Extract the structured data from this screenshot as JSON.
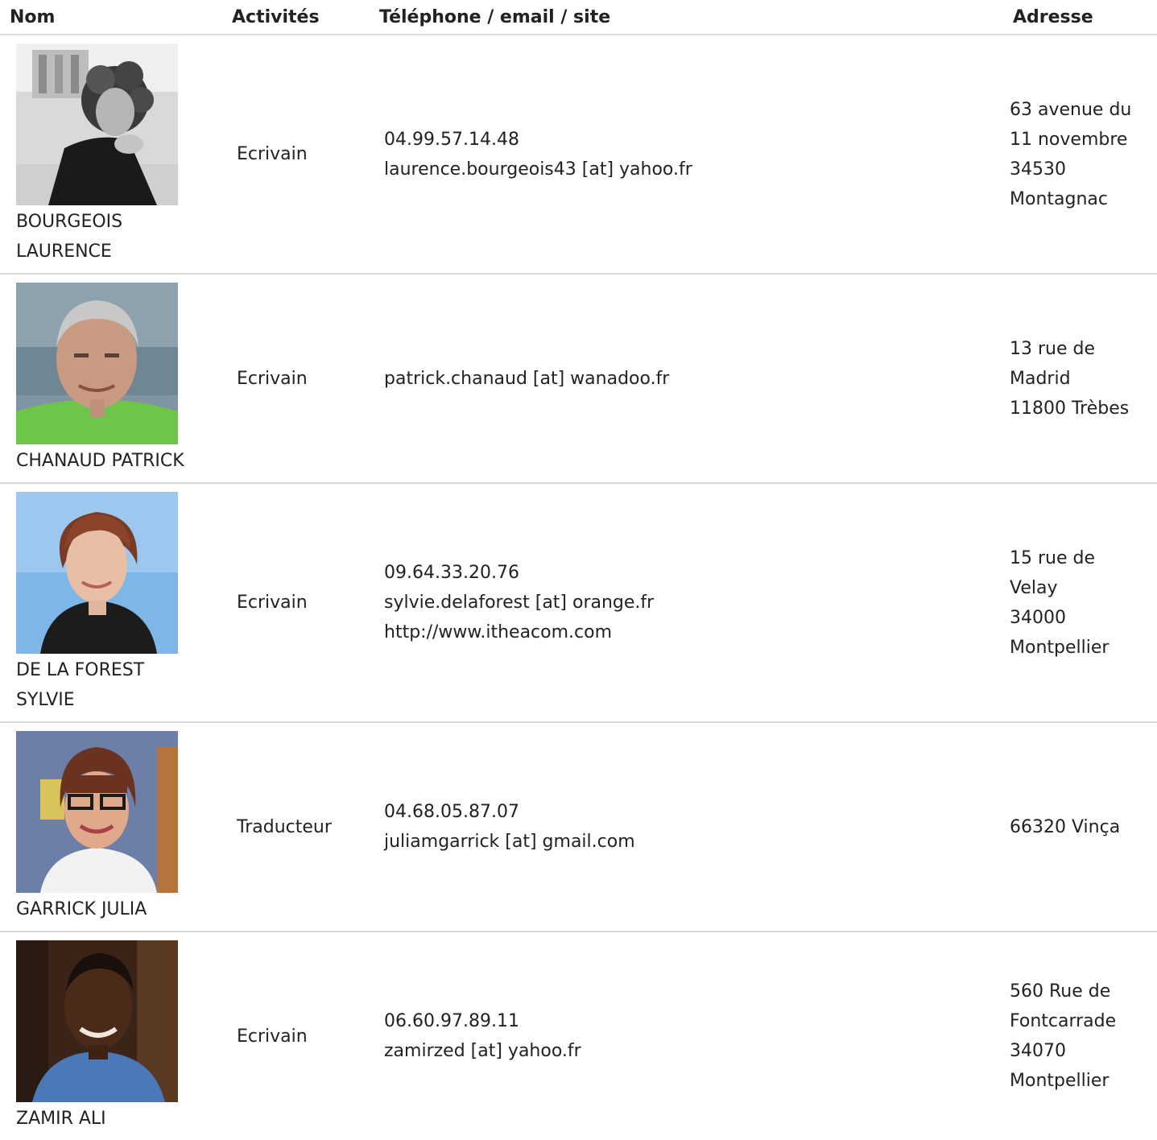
{
  "headers": {
    "nom": "Nom",
    "activites": "Activités",
    "contact": "Téléphone / email / site",
    "adresse": "Adresse"
  },
  "rows": [
    {
      "photo_icon": "portrait-photo-bw-woman-curly-hair",
      "name_lines": [
        "BOURGEOIS",
        "LAURENCE"
      ],
      "activity": "Ecrivain",
      "contact_lines": [
        "04.99.57.14.48",
        "laurence.bourgeois43 [at] yahoo.fr"
      ],
      "address_lines": [
        "63 avenue du",
        "11 novembre",
        "34530",
        "Montagnac"
      ]
    },
    {
      "photo_icon": "portrait-photo-man-green-shirt",
      "name_lines": [
        "CHANAUD PATRICK"
      ],
      "activity": "Ecrivain",
      "contact_lines": [
        "patrick.chanaud [at] wanadoo.fr"
      ],
      "address_lines": [
        "13 rue de",
        "Madrid",
        "11800 Trèbes"
      ]
    },
    {
      "photo_icon": "portrait-photo-woman-blue-background",
      "name_lines": [
        "DE LA FOREST",
        "SYLVIE"
      ],
      "activity": "Ecrivain",
      "contact_lines": [
        "09.64.33.20.76",
        "sylvie.delaforest [at] orange.fr",
        "http://www.itheacom.com"
      ],
      "address_lines": [
        "15 rue de",
        "Velay",
        "34000",
        "Montpellier"
      ]
    },
    {
      "photo_icon": "portrait-photo-woman-glasses",
      "name_lines": [
        "GARRICK JULIA"
      ],
      "activity": "Traducteur",
      "contact_lines": [
        "04.68.05.87.07",
        "juliamgarrick [at] gmail.com"
      ],
      "address_lines": [
        "66320 Vinça"
      ]
    },
    {
      "photo_icon": "portrait-photo-man-denim-shirt",
      "name_lines": [
        "ZAMIR ALI"
      ],
      "activity": "Ecrivain",
      "contact_lines": [
        "06.60.97.89.11",
        "zamirzed [at] yahoo.fr"
      ],
      "address_lines": [
        "560 Rue de",
        "Fontcarrade",
        "34070",
        "Montpellier"
      ]
    }
  ]
}
